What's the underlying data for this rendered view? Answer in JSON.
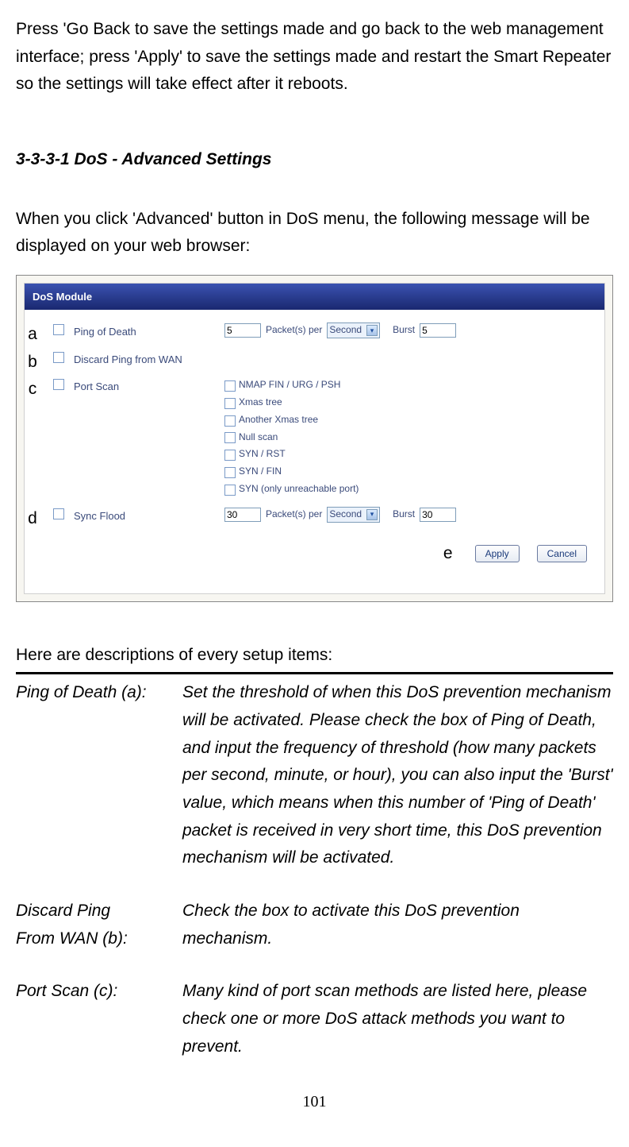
{
  "intro": "Press 'Go Back to save the settings made and go back to the web management interface; press 'Apply' to save the settings made and restart the Smart Repeater so the settings will take effect after it reboots.",
  "section_heading": "3-3-3-1 DoS - Advanced Settings",
  "sub_paragraph": "When you click 'Advanced' button in DoS menu, the following message will be displayed on your web browser:",
  "module": {
    "title": "DoS Module",
    "rows": {
      "a": {
        "letter": "a",
        "label": "Ping of Death",
        "packets_value": "5",
        "packets_per": "Packet(s) per",
        "unit": "Second",
        "burst_label": "Burst",
        "burst_value": "5"
      },
      "b": {
        "letter": "b",
        "label": "Discard Ping from WAN"
      },
      "c": {
        "letter": "c",
        "label": "Port Scan",
        "scans": [
          "NMAP FIN / URG / PSH",
          "Xmas tree",
          "Another Xmas tree",
          "Null scan",
          "SYN / RST",
          "SYN / FIN",
          "SYN (only unreachable port)"
        ]
      },
      "d": {
        "letter": "d",
        "label": "Sync Flood",
        "packets_value": "30",
        "packets_per": "Packet(s) per",
        "unit": "Second",
        "burst_label": "Burst",
        "burst_value": "30"
      }
    },
    "buttons": {
      "letter": "e",
      "apply": "Apply",
      "cancel": "Cancel"
    }
  },
  "desc_intro": "Here are descriptions of every setup items:",
  "descriptions": [
    {
      "label_lines": [
        "Ping of Death (a):"
      ],
      "text": "Set the threshold of when this DoS prevention mechanism will be activated. Please check the box of Ping of Death, and input the frequency of threshold (how many packets per second, minute, or hour), you can also input the 'Burst' value, which means when this number of 'Ping of Death' packet is received in very short time, this DoS prevention mechanism will be activated."
    },
    {
      "label_lines": [
        "Discard Ping",
        "From WAN (b):"
      ],
      "text": "Check the box to activate this DoS prevention mechanism."
    },
    {
      "label_lines": [
        "Port Scan (c):"
      ],
      "text": "Many kind of port scan methods are listed here, please check one or more DoS attack methods you want to prevent."
    }
  ],
  "page_number": "101"
}
